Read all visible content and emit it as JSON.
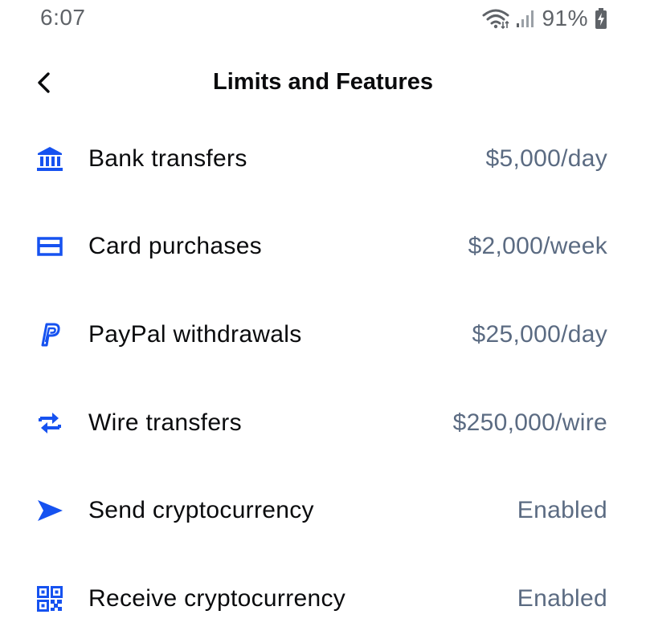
{
  "status_bar": {
    "time": "6:07",
    "battery": "91%",
    "icons": [
      "wifi-icon",
      "signal-icon",
      "battery-charging-icon"
    ]
  },
  "header": {
    "back_icon": "chevron-left-icon",
    "title": "Limits and Features"
  },
  "colors": {
    "accent": "#1652f0",
    "value_text": "#5b6b82",
    "label_text": "#0a0b0d",
    "status_text": "#5f6368"
  },
  "rows": [
    {
      "icon": "bank-icon",
      "label": "Bank transfers",
      "value": "$5,000/day"
    },
    {
      "icon": "card-icon",
      "label": "Card purchases",
      "value": "$2,000/week"
    },
    {
      "icon": "paypal-icon",
      "label": "PayPal withdrawals",
      "value": "$25,000/day"
    },
    {
      "icon": "wire-transfer-icon",
      "label": "Wire transfers",
      "value": "$250,000/wire"
    },
    {
      "icon": "send-icon",
      "label": "Send cryptocurrency",
      "value": "Enabled"
    },
    {
      "icon": "qr-code-icon",
      "label": "Receive cryptocurrency",
      "value": "Enabled"
    }
  ]
}
